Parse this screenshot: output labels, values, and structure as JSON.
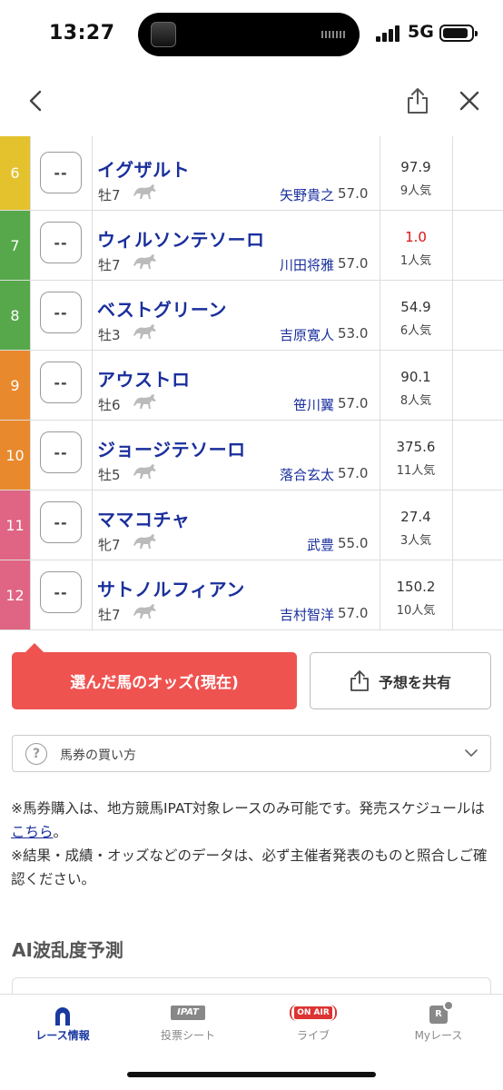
{
  "status": {
    "time": "13:27",
    "network": "5G"
  },
  "horses": [
    {
      "num": "6",
      "color": "#e4c22e",
      "select": "--",
      "name": "イグザルト",
      "sex_age": "牡7",
      "jockey": "矢野貴之",
      "weight": "57.0",
      "odds": "97.9",
      "popularity": "9人気",
      "favorite": false
    },
    {
      "num": "7",
      "color": "#56a84a",
      "select": "--",
      "name": "ウィルソンテソーロ",
      "sex_age": "牡7",
      "jockey": "川田将雅",
      "weight": "57.0",
      "odds": "1.0",
      "popularity": "1人気",
      "favorite": true
    },
    {
      "num": "8",
      "color": "#56a84a",
      "select": "--",
      "name": "ベストグリーン",
      "sex_age": "牡3",
      "jockey": "吉原寛人",
      "weight": "53.0",
      "odds": "54.9",
      "popularity": "6人気",
      "favorite": false
    },
    {
      "num": "9",
      "color": "#e8892d",
      "select": "--",
      "name": "アウストロ",
      "sex_age": "牡6",
      "jockey": "笹川翼",
      "weight": "57.0",
      "odds": "90.1",
      "popularity": "8人気",
      "favorite": false
    },
    {
      "num": "10",
      "color": "#e8892d",
      "select": "--",
      "name": "ジョージテソーロ",
      "sex_age": "牡5",
      "jockey": "落合玄太",
      "weight": "57.0",
      "odds": "375.6",
      "popularity": "11人気",
      "favorite": false
    },
    {
      "num": "11",
      "color": "#e06483",
      "select": "--",
      "name": "ママコチャ",
      "sex_age": "牝7",
      "jockey": "武豊",
      "weight": "55.0",
      "odds": "27.4",
      "popularity": "3人気",
      "favorite": false
    },
    {
      "num": "12",
      "color": "#e06483",
      "select": "--",
      "name": "サトノルフィアン",
      "sex_age": "牡7",
      "jockey": "吉村智洋",
      "weight": "57.0",
      "odds": "150.2",
      "popularity": "10人気",
      "favorite": false
    }
  ],
  "actions": {
    "odds_button": "選んだ馬のオッズ(現在)",
    "share_button": "予想を共有"
  },
  "howto": {
    "label": "馬券の買い方",
    "icon": "?"
  },
  "notes": {
    "line1": "※馬券購入は、地方競馬IPAT対象レースのみ可能です。発売スケジュールは",
    "link": "こちら",
    "line1_end": "。",
    "line2": "※結果・成績・オッズなどのデータは、必ず主催者発表のものと照合しご確認ください。"
  },
  "ai_section": {
    "title": "AI波乱度予測"
  },
  "tabs": [
    {
      "label": "レース情報",
      "active": true
    },
    {
      "label": "投票シート",
      "badge": "IPAT",
      "active": false
    },
    {
      "label": "ライブ",
      "badge": "ON AIR",
      "active": false
    },
    {
      "label": "Myレース",
      "badge": "R",
      "active": false
    }
  ],
  "colors": {
    "accent": "#ef5350",
    "link": "#1a2f9c",
    "favorite_odds": "#dd1111",
    "tab_active": "#1a3aa0"
  }
}
